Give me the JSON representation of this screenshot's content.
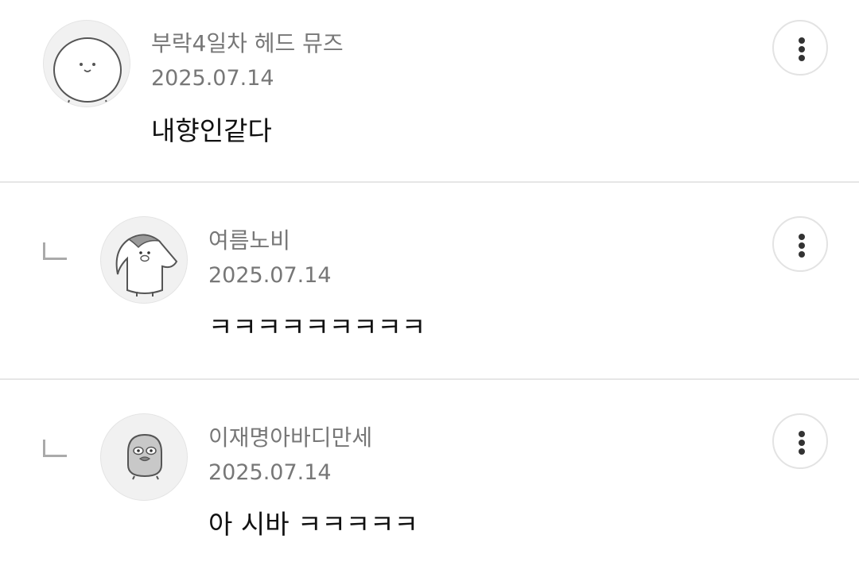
{
  "comments": [
    {
      "author": "부락4일차 헤드 뮤즈",
      "date": "2025.07.14",
      "text": "내향인같다",
      "avatar_icon": "seal-character-icon",
      "is_reply": false
    },
    {
      "author": "여름노비",
      "date": "2025.07.14",
      "text": "ㅋㅋㅋㅋㅋㅋㅋㅋㅋ",
      "avatar_icon": "penguin-character-icon",
      "is_reply": true
    },
    {
      "author": "이재명아바디만세",
      "date": "2025.07.14",
      "text": "아 시바 ㅋㅋㅋㅋㅋ",
      "avatar_icon": "duck-character-icon",
      "is_reply": true
    }
  ],
  "more_icon": "more-vertical-icon",
  "reply_icon": "reply-indent-icon",
  "colors": {
    "meta_text": "#777777",
    "body_text": "#111111",
    "divider": "#e6e6e6",
    "avatar_bg": "#f1f1f1"
  }
}
